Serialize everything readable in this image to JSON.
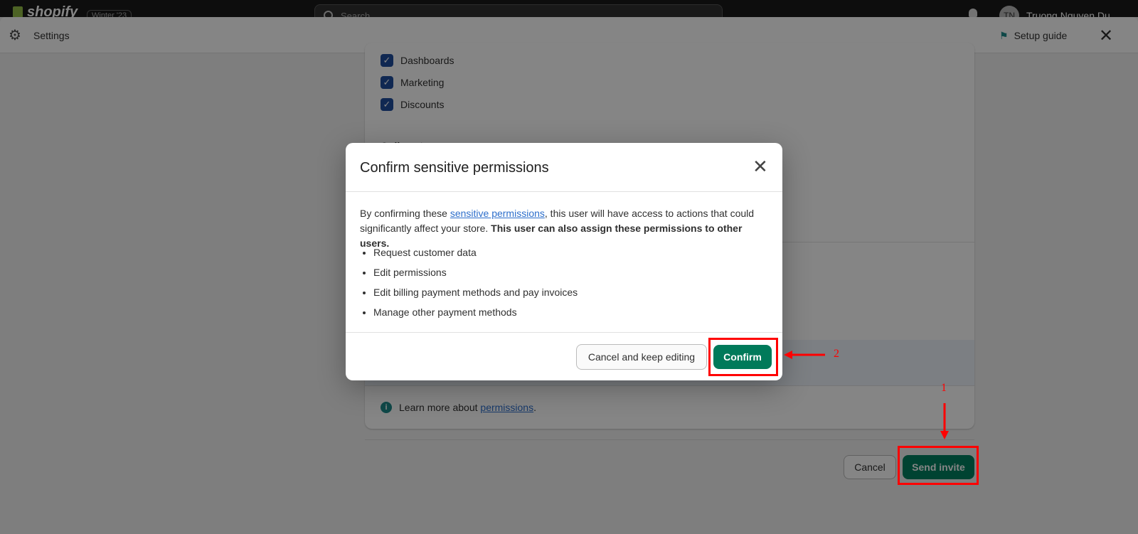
{
  "topbar": {
    "logo": "shopify",
    "edition": "Winter '23",
    "search_placeholder": "Search",
    "avatar_initials": "TN",
    "user_name": "Truong Nguyen Du"
  },
  "header": {
    "title": "Settings",
    "setup_guide": "Setup guide"
  },
  "permissions": {
    "items": [
      {
        "label": "Dashboards",
        "checked": true
      },
      {
        "label": "Marketing",
        "checked": true
      },
      {
        "label": "Discounts",
        "checked": true
      }
    ],
    "section": "Online store",
    "learn_prefix": "Learn more about ",
    "learn_link": "permissions",
    "learn_suffix": "."
  },
  "footer": {
    "cancel": "Cancel",
    "send_invite": "Send invite"
  },
  "modal": {
    "title": "Confirm sensitive permissions",
    "body_prefix": "By confirming these ",
    "body_link": "sensitive permissions",
    "body_mid": ", this user will have access to actions that could significantly affect your store. ",
    "body_bold": "This user can also assign these permissions to other users.",
    "list": [
      "Request customer data",
      "Edit permissions",
      "Edit billing payment methods and pay invoices",
      "Manage other payment methods"
    ],
    "cancel": "Cancel and keep editing",
    "confirm": "Confirm"
  },
  "annotations": {
    "step1": "1",
    "step2": "2",
    "color": "#ff0000"
  }
}
